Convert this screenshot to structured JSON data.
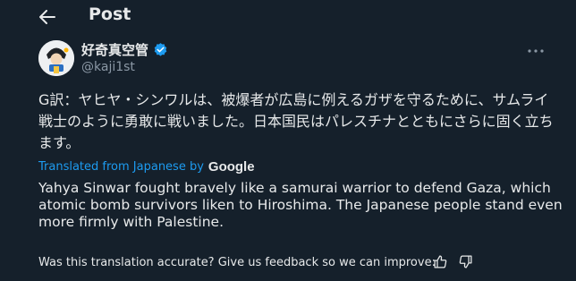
{
  "header": {
    "back_icon": "arrow-left-icon",
    "title": "Post"
  },
  "author": {
    "display_name": "好奇真空管",
    "handle": "@kaji1st",
    "verified_icon": "verified-badge-icon",
    "verified_color": "#1d9bf0"
  },
  "post": {
    "original_text": "G訳：ヤヒヤ・シンワルは、被爆者が広島に例えるガザを守るために、サムライ戦士のように勇敢に戦いました。日本国民はパレスチナとともにさらに固く立ちます。",
    "translated_from": "Translated from Japanese by",
    "translator_brand": "Google",
    "translation": "Yahya Sinwar fought bravely like a samurai warrior to defend Gaza, which atomic bomb survivors liken to Hiroshima. The Japanese people stand even more firmly with Palestine.",
    "more_icon": "more-horizontal-icon"
  },
  "feedback": {
    "prompt": "Was this translation accurate? Give us feedback so we can improve:",
    "thumbs_up_icon": "thumbs-up-icon",
    "thumbs_down_icon": "thumbs-down-icon"
  },
  "colors": {
    "background": "#15202b",
    "text": "#e7e9ea",
    "secondary_text": "#8b98a5",
    "accent": "#1d9bf0"
  }
}
